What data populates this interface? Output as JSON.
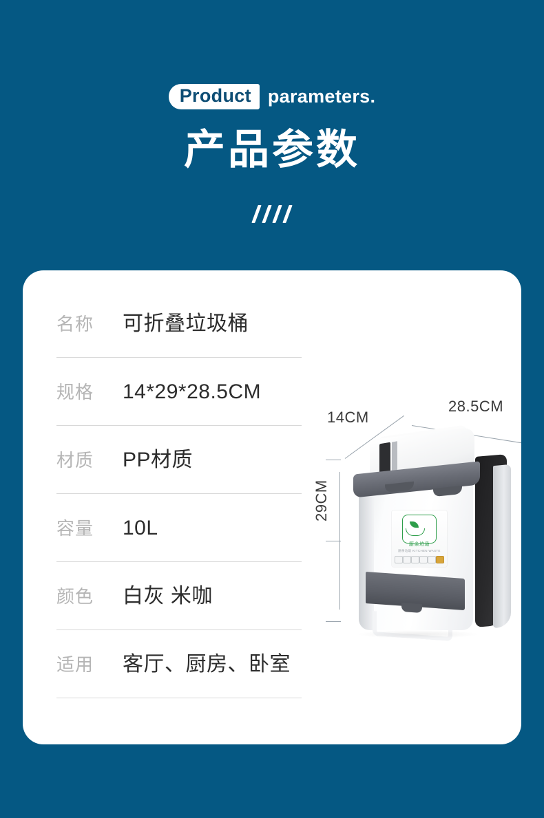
{
  "page": {
    "background_color": "#055883",
    "card_color": "#ffffff"
  },
  "header": {
    "eyebrow_highlight": "Product",
    "eyebrow_rest": "parameters.",
    "title_cn": "产品参数",
    "divider_icon": "slash-divider",
    "slash_count": 4
  },
  "spec_table": {
    "rows": [
      {
        "label": "名称",
        "value": "可折叠垃圾桶"
      },
      {
        "label": "规格",
        "value": "14*29*28.5CM"
      },
      {
        "label": "材质",
        "value": "PP材质"
      },
      {
        "label": "容量",
        "value": "10L"
      },
      {
        "label": "颜色",
        "value": "白灰 米咖"
      },
      {
        "label": "适用",
        "value": "客厅、厨房、卧室"
      }
    ]
  },
  "product_photo": {
    "alt_name": "foldable-trash-bin",
    "dimensions": {
      "width": "28.5CM",
      "depth": "14CM",
      "height": "29CM"
    },
    "sticker": {
      "label_cn": "厨余垃圾",
      "label_en": "厨余垃圾 KITCHEN WASTE",
      "logo_color": "#2e9e4a"
    }
  }
}
